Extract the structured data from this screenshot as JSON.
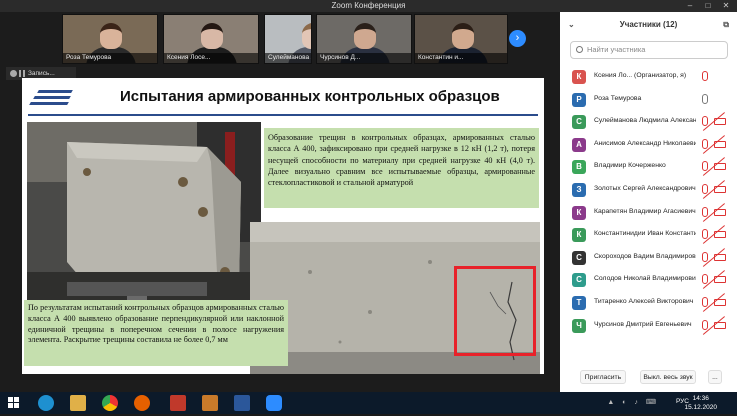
{
  "window": {
    "title": "Zoom Конференция"
  },
  "thumbnails": [
    {
      "name": "Роза Темурова",
      "bg": "#7a6a56",
      "skin": "#d9b39a",
      "shirt": "#2a2a2a",
      "hair": "#3a2418"
    },
    {
      "name": "Ксения Лосе...",
      "bg": "#8a7f74",
      "skin": "#d8b8a6",
      "shirt": "#1e1e1e",
      "hair": "#231712"
    },
    {
      "name": "Сулейманова Л...",
      "bg": "#b9bdc0",
      "skin": "#e2c6b6",
      "shirt": "#555a66",
      "hair": "#8c6a4a"
    },
    {
      "name": "Чурсинов Д...",
      "bg": "#6d6a66",
      "skin": "#cfa890",
      "shirt": "#2a3040",
      "hair": "#2a201a"
    },
    {
      "name": "Константин и...",
      "bg": "#5b5147",
      "skin": "#d1a98e",
      "shirt": "#1b2230",
      "hair": "#2b1e16"
    }
  ],
  "recording": {
    "label": "Запись..."
  },
  "slide": {
    "title": "Испытания армированных контрольных образцов",
    "caption1": "Образование трещин в контрольных образцах, армированных сталью класса А 400, зафиксировано при средней нагрузке в 12 кН (1,2 т), потеря несущей способности по материалу при средней нагрузке 40 кН (4,0 т). Далее визуально сравним все испытываемые образцы, армированные стеклопластиковой и стальной арматурой",
    "caption2": "По результатам испытаний контрольных образцов армированных сталью класса А 400 выявлено образование перпендикулярной или наклонной единичной трещины в поперечном сечении в полосе нагружения элемента. Раскрытие трещины составила не более 0,7 мм"
  },
  "participants": {
    "header": "Участники (12)",
    "search_placeholder": "Найти участника",
    "list": [
      {
        "initial": "К",
        "color": "#d9534f",
        "name": "Ксения Ло... (Организатор, я)",
        "muted": true,
        "video_off": false
      },
      {
        "initial": "Р",
        "color": "#2b6cb0",
        "name": "Роза Темурова",
        "muted": false,
        "video_off": false
      },
      {
        "initial": "С",
        "color": "#3a9a5a",
        "name": "Сулейманова Людмила Алексан...",
        "muted": true,
        "video_off": true
      },
      {
        "initial": "А",
        "color": "#8b3a8b",
        "name": "Анисимов Александр Николаевич",
        "muted": true,
        "video_off": true
      },
      {
        "initial": "В",
        "color": "#3aa65a",
        "name": "Владимир Кочерженко",
        "muted": true,
        "video_off": true
      },
      {
        "initial": "З",
        "color": "#2b6cb0",
        "name": "Золотых Сергей Александрович",
        "muted": true,
        "video_off": true
      },
      {
        "initial": "К",
        "color": "#8b3a8b",
        "name": "Карапетян Владимир Агасиевич",
        "muted": true,
        "video_off": true
      },
      {
        "initial": "К",
        "color": "#3a9a5a",
        "name": "Константинидии Иван Константин...",
        "muted": true,
        "video_off": true
      },
      {
        "initial": "С",
        "color": "#333333",
        "name": "Скороходов Вадим Владимирови...",
        "muted": true,
        "video_off": true
      },
      {
        "initial": "С",
        "color": "#2e9c8c",
        "name": "Солодов Николай Владимирович",
        "muted": true,
        "video_off": true
      },
      {
        "initial": "Т",
        "color": "#2b6cb0",
        "name": "Титаренко Алексей Викторович",
        "muted": true,
        "video_off": true
      },
      {
        "initial": "Ч",
        "color": "#3a9a5a",
        "name": "Чурсинов Дмитрий Евгеньевич",
        "muted": true,
        "video_off": true
      }
    ],
    "invite_label": "Пригласить",
    "mute_all_label": "Выкл. весь звук",
    "more_label": "..."
  },
  "taskbar": {
    "time": "14:36",
    "date": "15.12.2020",
    "lang": "РУС"
  }
}
